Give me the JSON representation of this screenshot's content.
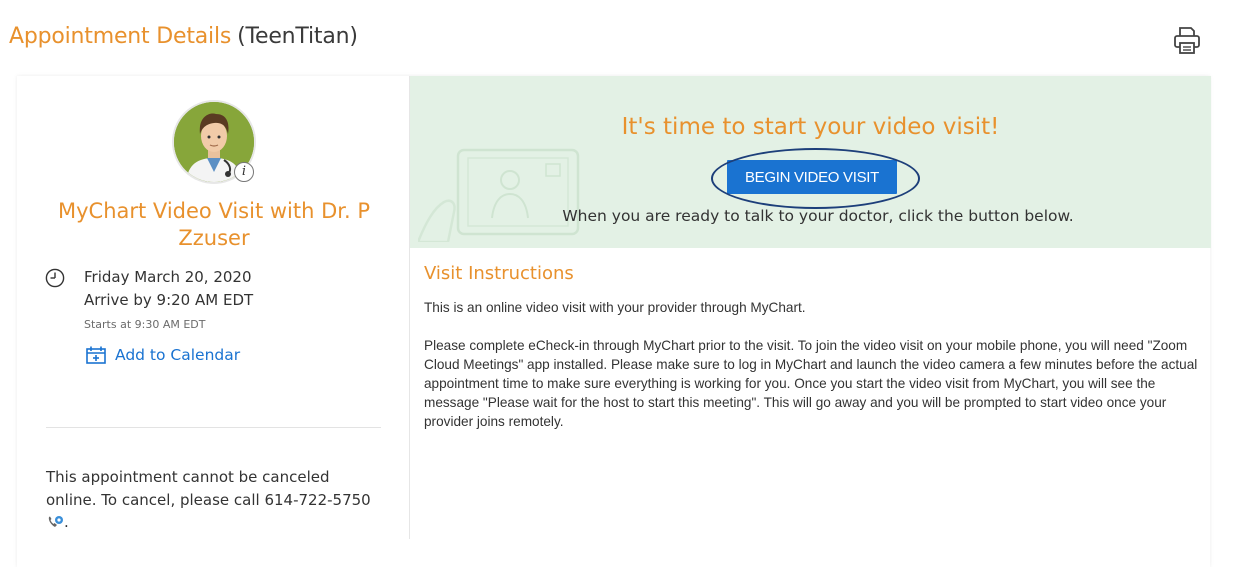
{
  "header": {
    "title": "Appointment Details",
    "patient": "(TeenTitan)",
    "print_icon": "printer-icon"
  },
  "appointment": {
    "avatar_icon": "doctor-avatar",
    "info_icon": "i",
    "title": "MyChart Video Visit with Dr. P Zzuser",
    "date": "Friday March 20, 2020",
    "arrive": "Arrive by 9:20 AM EDT",
    "starts": "Starts at 9:30 AM EDT",
    "add_calendar": "Add to Calendar",
    "cancel_note": "This appointment cannot be canceled online. To cancel, please call",
    "phone": "614-722-5750",
    "phone_suffix": "."
  },
  "video_banner": {
    "heading": "It's time to start your video visit!",
    "button_label": "BEGIN VIDEO VISIT",
    "subtext": "When you are ready to talk to your doctor, click the button below."
  },
  "instructions": {
    "heading": "Visit Instructions",
    "paragraphs": [
      "This is an online video visit with your provider through MyChart.",
      "Please complete eCheck-in through MyChart prior to the visit. To join the video visit on your mobile phone, you will need \"Zoom Cloud Meetings\" app installed. Please make sure to log in MyChart and launch the video camera a few minutes before the actual appointment time to make sure everything is working for you. Once you start the video visit from MyChart, you will see the message \"Please wait for the host to start this meeting\". This will go away and you will be prompted to start video once your provider joins remotely."
    ]
  },
  "colors": {
    "accent_orange": "#e8912d",
    "link_blue": "#1a73d1",
    "banner_green": "#e3f1e5",
    "ring_navy": "#1d3f7a"
  }
}
